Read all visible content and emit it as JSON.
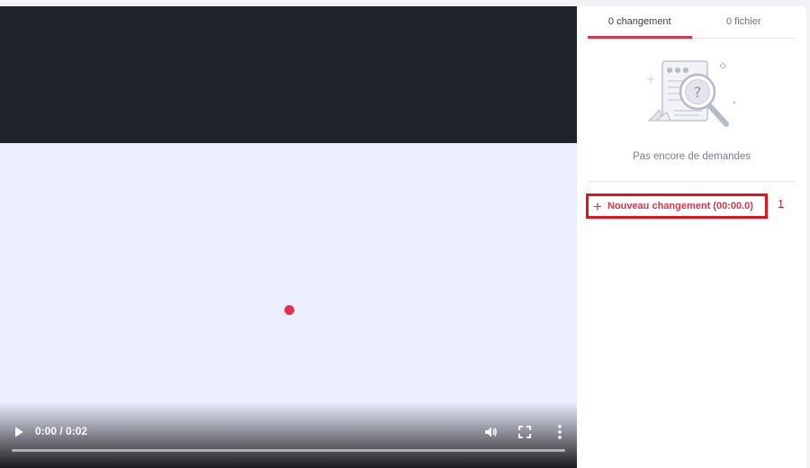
{
  "video": {
    "time_display": "0:00 / 0:02",
    "progress": 0.0,
    "icons": {
      "play": "play-icon",
      "volume": "volume-icon",
      "fullscreen": "fullscreen-icon",
      "more": "more-options-icon"
    }
  },
  "panel": {
    "tabs": [
      {
        "label": "0 changement",
        "active": true
      },
      {
        "label": "0 fichier",
        "active": false
      }
    ],
    "empty_state": {
      "icon": "search-document-illustration",
      "text": "Pas encore de demandes"
    },
    "new_change_button": {
      "icon": "plus-icon",
      "label": "Nouveau changement (00:00.0)"
    },
    "annotation": "1"
  },
  "colors": {
    "accent": "#e0334d",
    "highlight_box": "#e3121d",
    "video_header": "#20232b",
    "video_body": "#ebeefe"
  }
}
